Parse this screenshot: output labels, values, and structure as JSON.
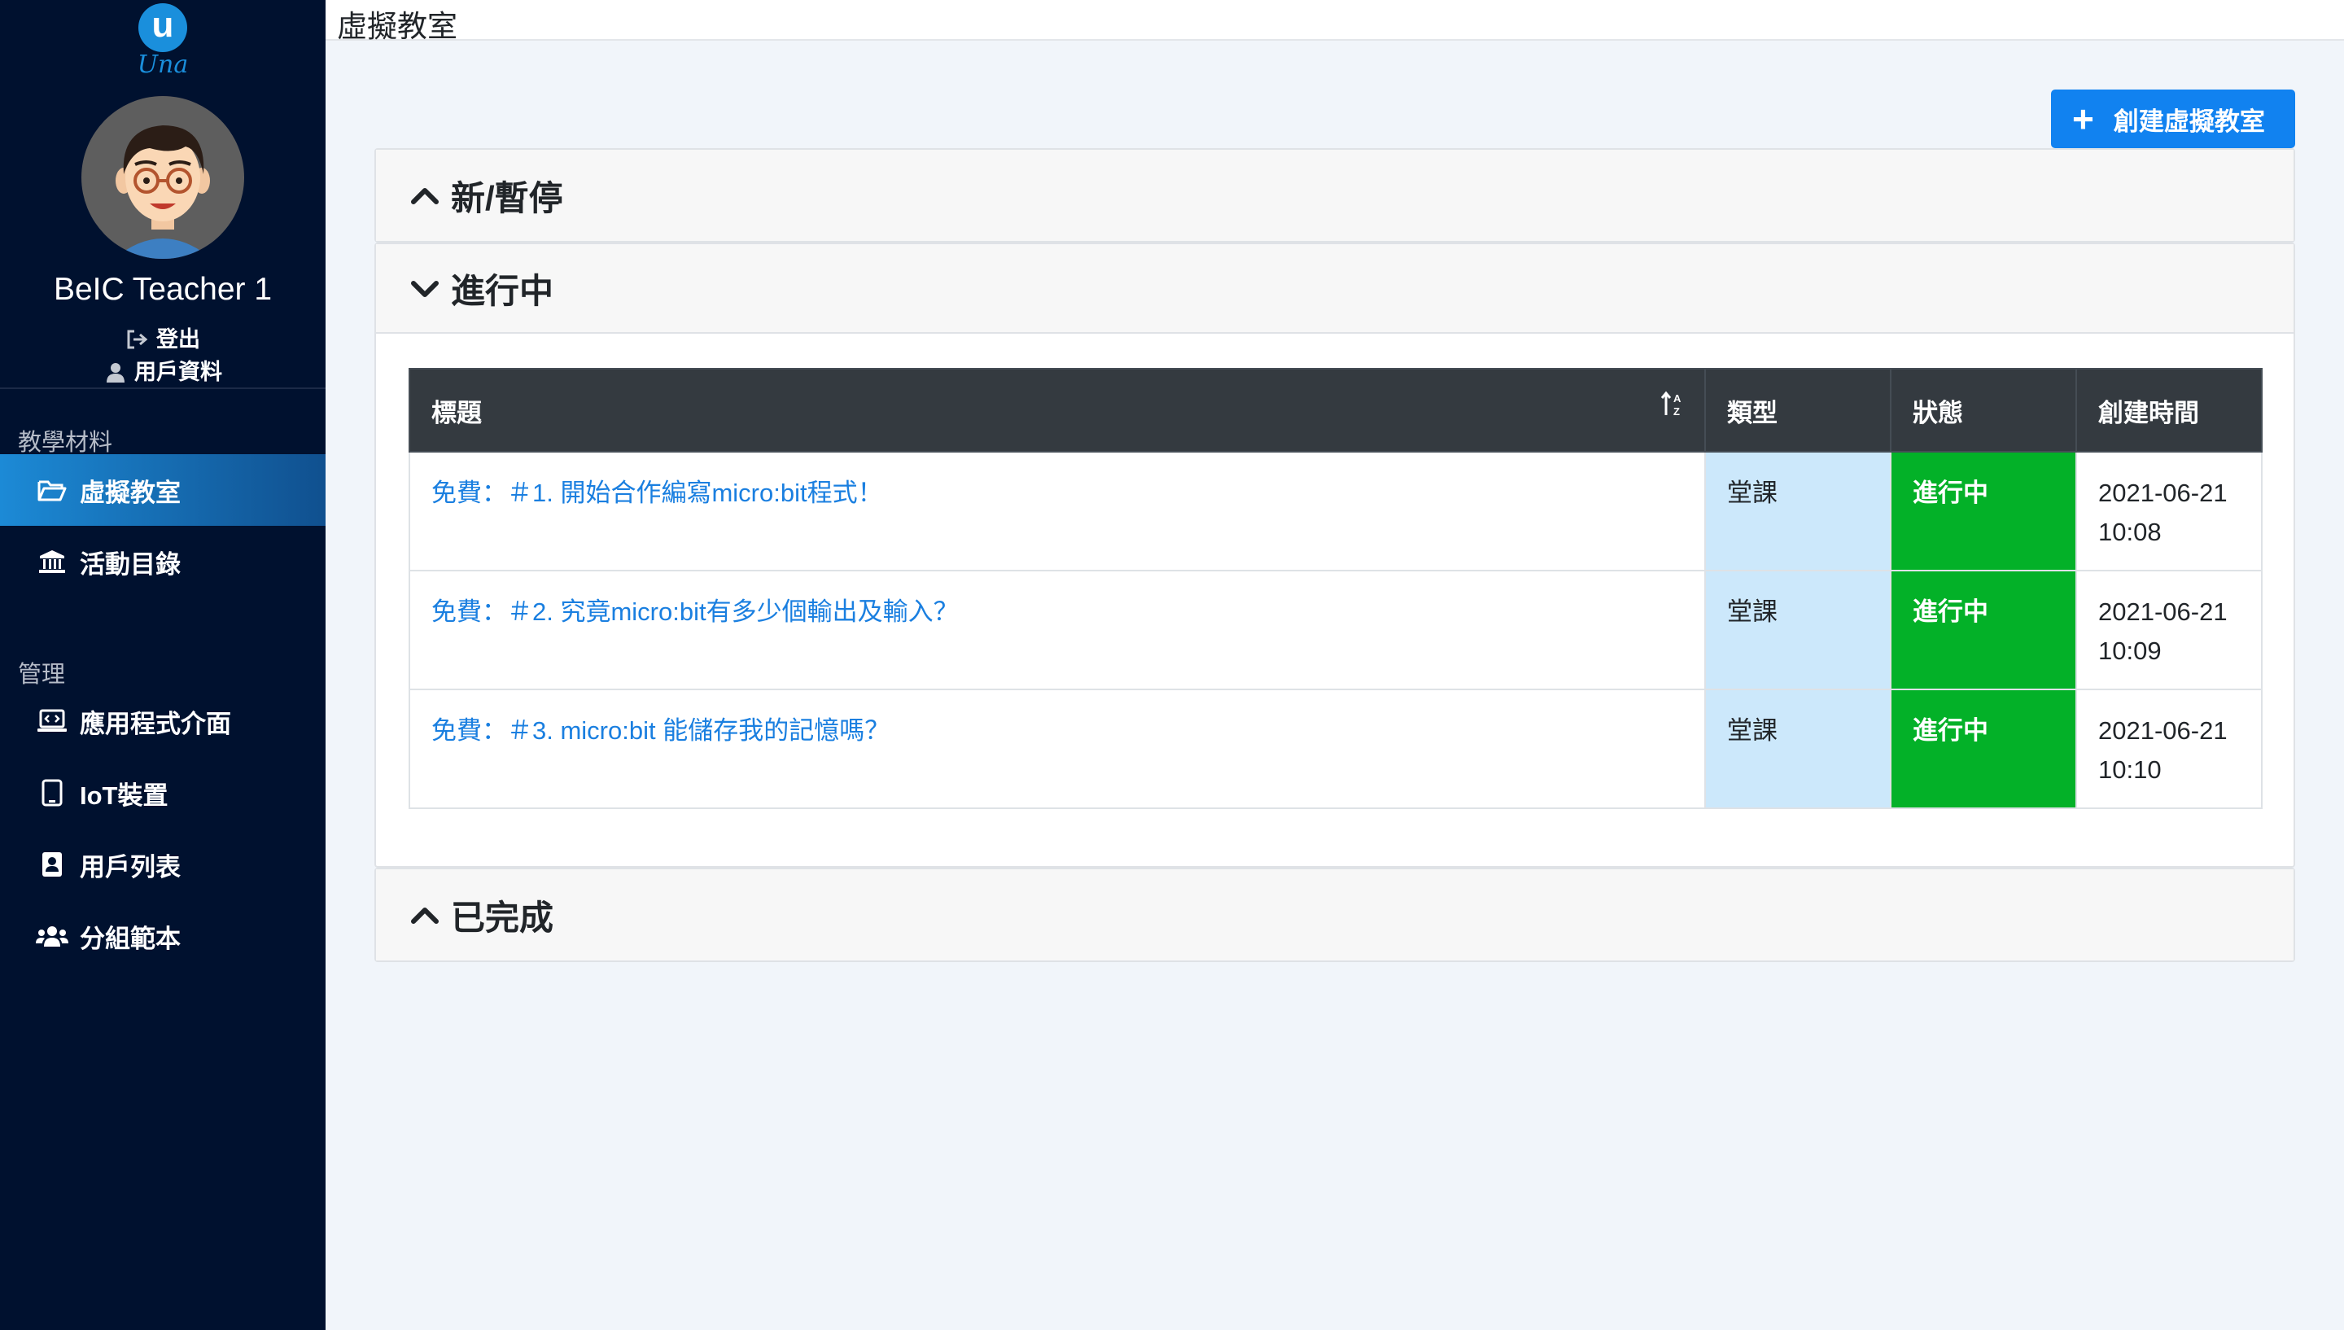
{
  "app": {
    "logo_text": "Una",
    "logo_letter": "u",
    "page_title": "虛擬教室"
  },
  "user": {
    "name": "BeIC Teacher 1",
    "logout_label": "登出",
    "profile_label": "用戶資料"
  },
  "sidebar": {
    "sections": [
      {
        "label": "教學材料"
      },
      {
        "label": "管理"
      }
    ],
    "items": [
      {
        "label": "虛擬教室",
        "icon": "folder-open-icon",
        "active": true
      },
      {
        "label": "活動目錄",
        "icon": "building-columns-icon",
        "active": false
      },
      {
        "label": "應用程式介面",
        "icon": "laptop-code-icon",
        "active": false
      },
      {
        "label": "IoT裝置",
        "icon": "tablet-icon",
        "active": false
      },
      {
        "label": "用戶列表",
        "icon": "address-book-icon",
        "active": false
      },
      {
        "label": "分組範本",
        "icon": "users-icon",
        "active": false
      }
    ]
  },
  "toolbar": {
    "create_label": "創建虛擬教室"
  },
  "panels": [
    {
      "label": "新/暫停",
      "expanded": false
    },
    {
      "label": "進行中",
      "expanded": true
    },
    {
      "label": "已完成",
      "expanded": false
    }
  ],
  "table": {
    "headers": [
      "標題",
      "類型",
      "狀態",
      "創建時間"
    ],
    "rows": [
      {
        "title": "免費：＃1. 開始合作編寫micro:bit程式！",
        "type": "堂課",
        "status": "進行中",
        "date": "2021-06-21",
        "time": "10:08"
      },
      {
        "title": "免費：＃2. 究竟micro:bit有多少個輸出及輸入？",
        "type": "堂課",
        "status": "進行中",
        "date": "2021-06-21",
        "time": "10:09"
      },
      {
        "title": "免費：＃3. micro:bit 能儲存我的記憶嗎？",
        "type": "堂課",
        "status": "進行中",
        "date": "2021-06-21",
        "time": "10:10"
      }
    ]
  },
  "colors": {
    "sidebar_bg": "#00112f",
    "accent": "#1182f0",
    "status_active": "#03b128",
    "type_bg": "#cce8fb",
    "link": "#1a7fe0"
  }
}
